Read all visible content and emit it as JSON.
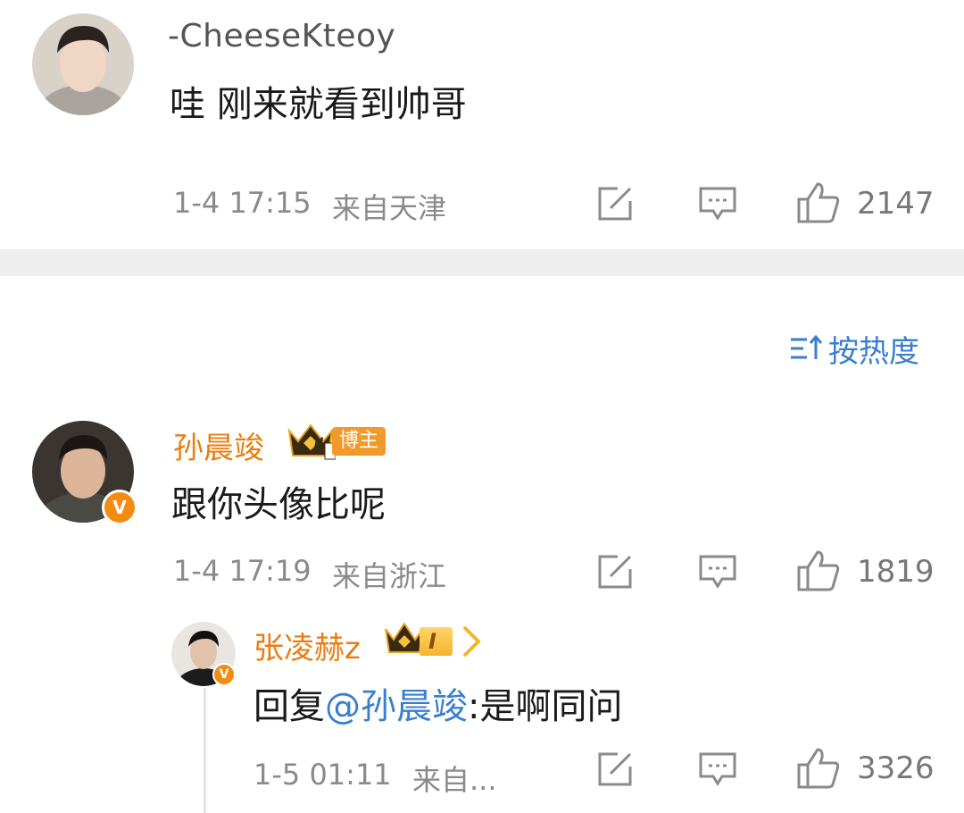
{
  "comments": [
    {
      "username": "-CheeseKteoy",
      "text": "哇 刚来就看到帅哥",
      "time": "1-4 17:15",
      "location": "来自天津",
      "likes": "2147"
    },
    {
      "username": "孙晨竣",
      "badge": "博主",
      "level": "II",
      "text": "跟你头像比呢",
      "time": "1-4 17:19",
      "location": "来自浙江",
      "likes": "1819"
    }
  ],
  "reply": {
    "username": "张凌赫z",
    "level": "I",
    "prefix": "回复",
    "mention": "@孙晨竣",
    "text": ":是啊同问",
    "time": "1-5 01:11",
    "location": "来自...",
    "likes": "3326"
  },
  "sort": {
    "label": "按热度",
    "icon": "sort-icon"
  },
  "colors": {
    "vip_name": "#e87d12",
    "link": "#3a7fcf",
    "meta": "#8a8a8a",
    "divider": "#eeeeee"
  },
  "icons": [
    "edit-icon",
    "comment-icon",
    "like-icon",
    "verified-icon",
    "crown-icon"
  ]
}
